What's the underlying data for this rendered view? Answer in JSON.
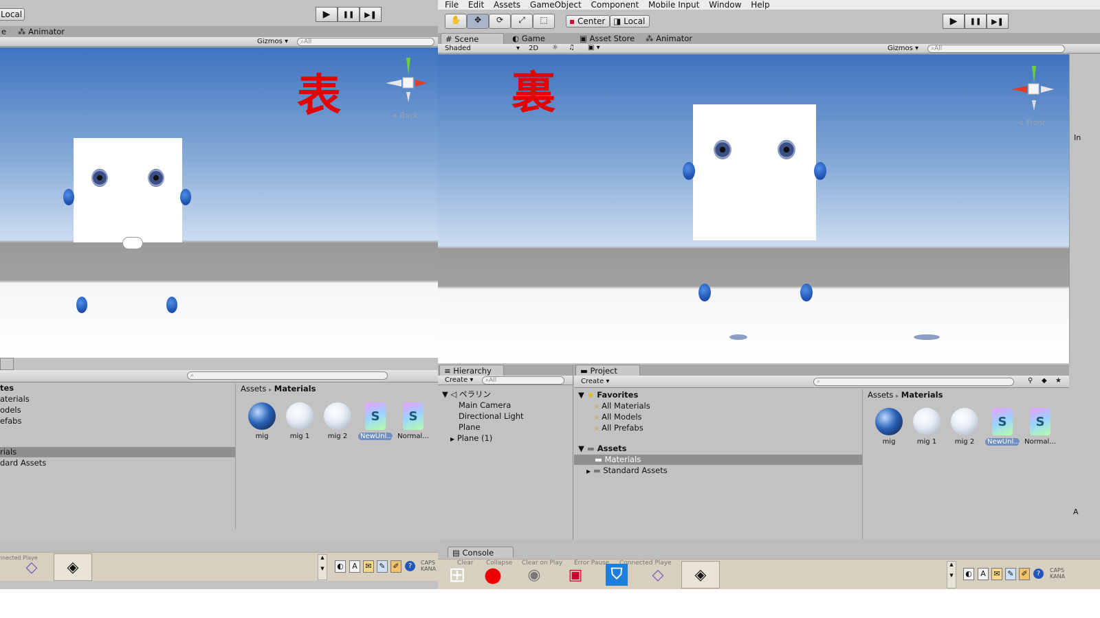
{
  "left": {
    "toolbar": {
      "local_label": "Local"
    },
    "tabs": {
      "partial_tab": "e",
      "animator": "Animator"
    },
    "scene_toolbar": {
      "gizmos": "Gizmos",
      "search_placeholder": "All"
    },
    "overlay_char": "表",
    "gizmo_label": "Back",
    "project": {
      "tree": [
        "tes",
        "aterials",
        "odels",
        "efabs",
        "rials",
        "dard Assets"
      ],
      "breadcrumb_root": "Assets",
      "breadcrumb_sep": "▸",
      "breadcrumb_current": "Materials",
      "assets": [
        {
          "label": "mig",
          "kind": "mig"
        },
        {
          "label": "mig 1",
          "kind": "sphere"
        },
        {
          "label": "mig 2",
          "kind": "sphere"
        },
        {
          "label": "NewUnl...",
          "kind": "shader",
          "selected": true
        },
        {
          "label": "Normal...",
          "kind": "shader"
        }
      ],
      "shader_glyph": "S"
    },
    "console_partial": "nnected Playe"
  },
  "right": {
    "menu": [
      "File",
      "Edit",
      "Assets",
      "GameObject",
      "Component",
      "Mobile Input",
      "Window",
      "Help"
    ],
    "toolbar": {
      "center_label": "Center",
      "local_label": "Local"
    },
    "tabs": {
      "scene": "Scene",
      "game": "Game",
      "asset_store": "Asset Store",
      "animator": "Animator"
    },
    "scene_toolbar": {
      "shading_mode": "Shaded",
      "mode_2d": "2D",
      "gizmos": "Gizmos",
      "search_placeholder": "All"
    },
    "overlay_char": "裏",
    "gizmo_label": "Front",
    "hierarchy": {
      "tab": "Hierarchy",
      "create": "Create",
      "search_placeholder": "All",
      "scene_name": "ペラリン",
      "items": [
        "Main Camera",
        "Directional Light",
        "Plane",
        "Plane (1)"
      ]
    },
    "project": {
      "tab": "Project",
      "create": "Create",
      "favorites_header": "Favorites",
      "favorites": [
        "All Materials",
        "All Models",
        "All Prefabs"
      ],
      "assets_header": "Assets",
      "asset_folders": [
        "Materials",
        "Standard Assets"
      ],
      "breadcrumb_root": "Assets",
      "breadcrumb_sep": "▸",
      "breadcrumb_current": "Materials",
      "assets": [
        {
          "label": "mig",
          "kind": "mig"
        },
        {
          "label": "mig 1",
          "kind": "sphere"
        },
        {
          "label": "mig 2",
          "kind": "sphere"
        },
        {
          "label": "NewUnl...",
          "kind": "shader",
          "selected": true
        },
        {
          "label": "Normal...",
          "kind": "shader"
        }
      ],
      "shader_glyph": "S"
    },
    "console": {
      "tab": "Console",
      "buttons": [
        "Clear",
        "Collapse",
        "Clear on Play",
        "Error Pause",
        "Connected Playe"
      ]
    },
    "edge_chars": {
      "inspector": "In",
      "a": "A"
    }
  },
  "tray": {
    "caps": "CAPS",
    "kana": "KANA"
  },
  "icons": {
    "play": "▶",
    "pause": "❚❚",
    "step": "▶❚",
    "hand": "✋",
    "move": "✥",
    "rotate": "⟳",
    "scale": "⤢",
    "rect": "⬚",
    "search": "⌕",
    "lock": "🔒",
    "menu": "≡",
    "star": "★",
    "folder": "▬",
    "arrow_down": "▼",
    "arrow_right": "▶",
    "windows": "⊞",
    "record": "●",
    "speaker": "◉",
    "vs": "◇",
    "unity": "◈",
    "help": "?"
  }
}
